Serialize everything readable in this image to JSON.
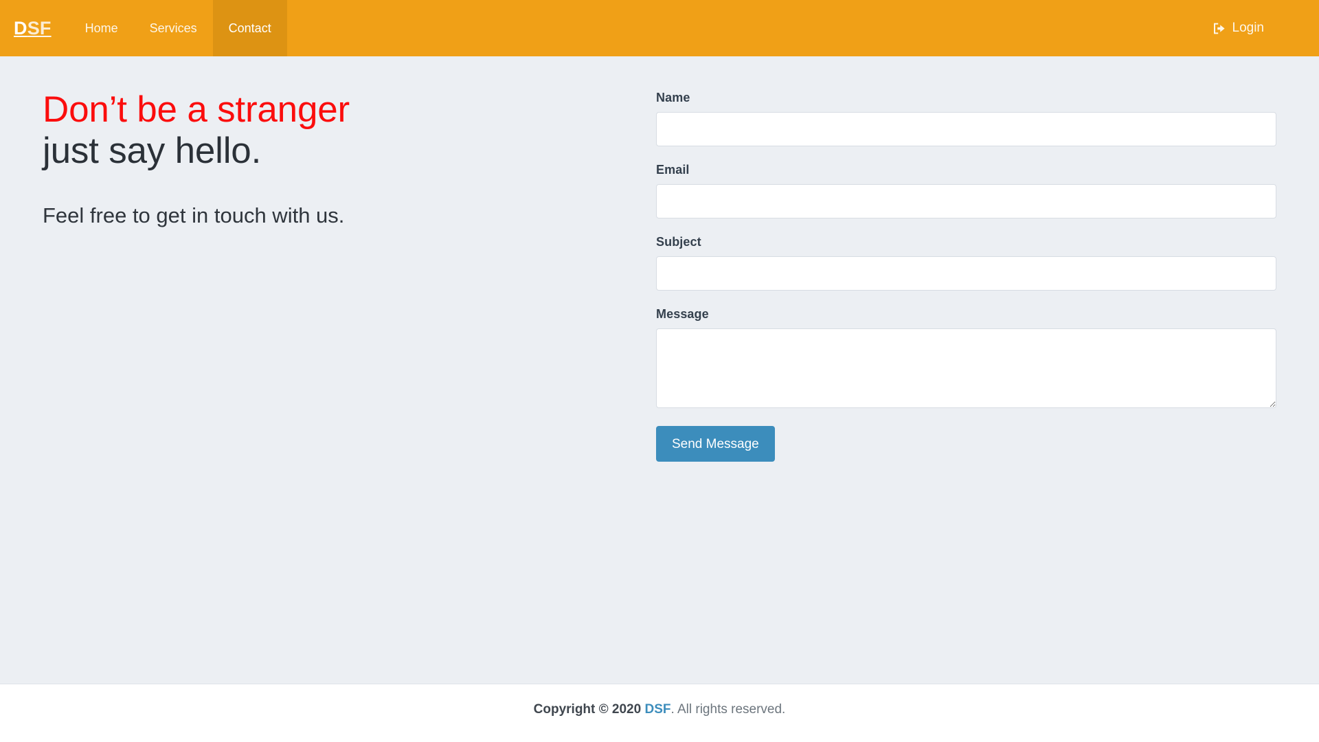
{
  "navbar": {
    "brand": {
      "part1": "D",
      "part2": "SF",
      "full": "DSF"
    },
    "links": [
      {
        "label": "Home",
        "active": false
      },
      {
        "label": "Services",
        "active": false
      },
      {
        "label": "Contact",
        "active": true
      }
    ],
    "login": {
      "label": "Login",
      "icon": "sign-in-icon"
    },
    "colors": {
      "background": "#f0a017",
      "active_background": "#dd9313",
      "text": "#fdf6ea"
    }
  },
  "hero": {
    "headline_line1": "Don’t be a stranger",
    "headline_line2": "just say hello.",
    "subtext": "Feel free to get in touch with us.",
    "colors": {
      "headline_accent": "#fb0d0d",
      "headline_dark": "#2b3138"
    }
  },
  "form": {
    "fields": [
      {
        "label": "Name",
        "value": "",
        "placeholder": "",
        "type": "text",
        "name": "name-input"
      },
      {
        "label": "Email",
        "value": "",
        "placeholder": "",
        "type": "email",
        "name": "email-input"
      },
      {
        "label": "Subject",
        "value": "",
        "placeholder": "",
        "type": "text",
        "name": "subject-input"
      },
      {
        "label": "Message",
        "value": "",
        "placeholder": "",
        "type": "textarea",
        "name": "message-textarea"
      }
    ],
    "submit_label": "Send Message",
    "colors": {
      "button": "#3c8dbc",
      "field_border": "#d7dce3",
      "field_background": "#ffffff"
    }
  },
  "footer": {
    "copyright_prefix": "Copyright © 2020 ",
    "brand": "DSF",
    "copyright_suffix": ". All rights reserved.",
    "colors": {
      "brand": "#3c8dbc",
      "text": "#6c757d"
    }
  },
  "page": {
    "background": "#eceff3",
    "footer_background": "#ffffff"
  }
}
